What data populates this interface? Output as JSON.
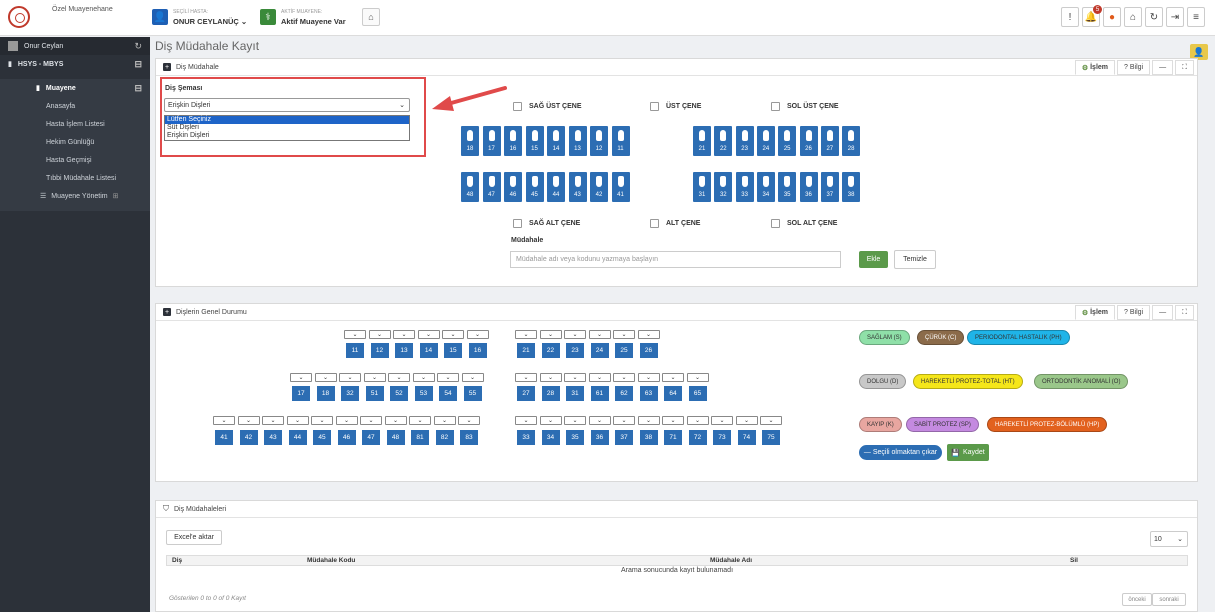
{
  "header": {
    "org": "Özel Muayenehane",
    "patient_caption": "SEÇİLİ HASTA:",
    "patient_name": "ONUR CEYLANÜÇ ⌄",
    "exam_caption": "AKTİF MUAYENE:",
    "exam_value": "Aktif Muayene Var",
    "notification_count": "5",
    "colors": {
      "brand_blue": "#1e5fb4",
      "green": "#3a8a3a"
    }
  },
  "sidebar": {
    "user": "Onur Ceylan",
    "module": "HSYS - MBYS",
    "section": "Muayene",
    "items": [
      "Anasayfa",
      "Hasta İşlem Listesi",
      "Hekim Günlüğü",
      "Hasta Geçmişi",
      "Tıbbi Müdahale Listesi"
    ],
    "sub_section": "Muayene Yönetim"
  },
  "page": {
    "title": "Diş Müdahale Kayıt"
  },
  "panel1": {
    "title": "Diş Müdahale",
    "islem": "İşlem",
    "bilgi": "? Bilgi",
    "sema_label": "Diş Şeması",
    "sema_selected": "Erişkin Dişleri",
    "sema_options": [
      "Lütfen Seçiniz",
      "Süt Dişleri",
      "Erişkin Dişleri"
    ],
    "upper_checks": [
      "SAĞ ÜST ÇENE",
      "ÜST ÇENE",
      "SOL ÜST ÇENE"
    ],
    "lower_checks": [
      "SAĞ ALT ÇENE",
      "ALT ÇENE",
      "SOL ALT ÇENE"
    ],
    "upper_teeth": [
      "18",
      "17",
      "16",
      "15",
      "14",
      "13",
      "12",
      "11",
      "21",
      "22",
      "23",
      "24",
      "25",
      "26",
      "27",
      "28"
    ],
    "lower_teeth": [
      "48",
      "47",
      "46",
      "45",
      "44",
      "43",
      "42",
      "41",
      "31",
      "32",
      "33",
      "34",
      "35",
      "36",
      "37",
      "38"
    ],
    "mudahale_label": "Müdahale",
    "mudahale_placeholder": "Müdahale adı veya kodunu yazmaya başlayın",
    "add_button": "Ekle",
    "clear_button": "Temizle"
  },
  "panel2": {
    "title": "Dişlerin Genel Durumu",
    "islem": "İşlem",
    "bilgi": "? Bilgi",
    "row1": [
      "11",
      "12",
      "13",
      "14",
      "15",
      "16",
      "21",
      "22",
      "23",
      "24",
      "25",
      "26"
    ],
    "row2": [
      "17",
      "18",
      "32",
      "51",
      "52",
      "53",
      "54",
      "55",
      "27",
      "28",
      "31",
      "61",
      "62",
      "63",
      "64",
      "65"
    ],
    "row3": [
      "41",
      "42",
      "43",
      "44",
      "45",
      "46",
      "47",
      "48",
      "81",
      "82",
      "83",
      "33",
      "34",
      "35",
      "36",
      "37",
      "38",
      "71",
      "72",
      "73",
      "74",
      "75"
    ],
    "legend": [
      {
        "label": "SAĞLAM (S)",
        "color": "#8fe0a8"
      },
      {
        "label": "ÇÜRÜK (C)",
        "color": "#8b6b4a"
      },
      {
        "label": "PERIODONTAL HASTALIK (PH)",
        "color": "#1fb4e8"
      },
      {
        "label": "DOLGU (D)",
        "color": "#c8c8c8"
      },
      {
        "label": "HAREKETLİ PROTEZ-TOTAL (HT)",
        "color": "#f5e61a"
      },
      {
        "label": "ORTODONTİK ANOMALİ (O)",
        "color": "#9ac78a"
      },
      {
        "label": "KAYIP (K)",
        "color": "#e8a6a0"
      },
      {
        "label": "SABİT PROTEZ (SP)",
        "color": "#c48ae0"
      },
      {
        "label": "HAREKETLİ PROTEZ-BÖLÜMLÜ (HP)",
        "color": "#e2611e"
      }
    ],
    "remove_button": "— Seçili olmaktan çıkar",
    "save_button": "Kaydet"
  },
  "panel3": {
    "title": "Diş Müdahaleleri",
    "excel_button": "Excel'e aktar",
    "page_size": "10",
    "columns": [
      "Diş",
      "Müdahale Kodu",
      "Müdahale Adı",
      "Sil"
    ],
    "empty_message": "Arama sonucunda kayıt bulunamadı",
    "footer": "Gösterilen 0 to 0 of 0 Kayıt",
    "prev": "önceki",
    "next": "sonraki"
  }
}
